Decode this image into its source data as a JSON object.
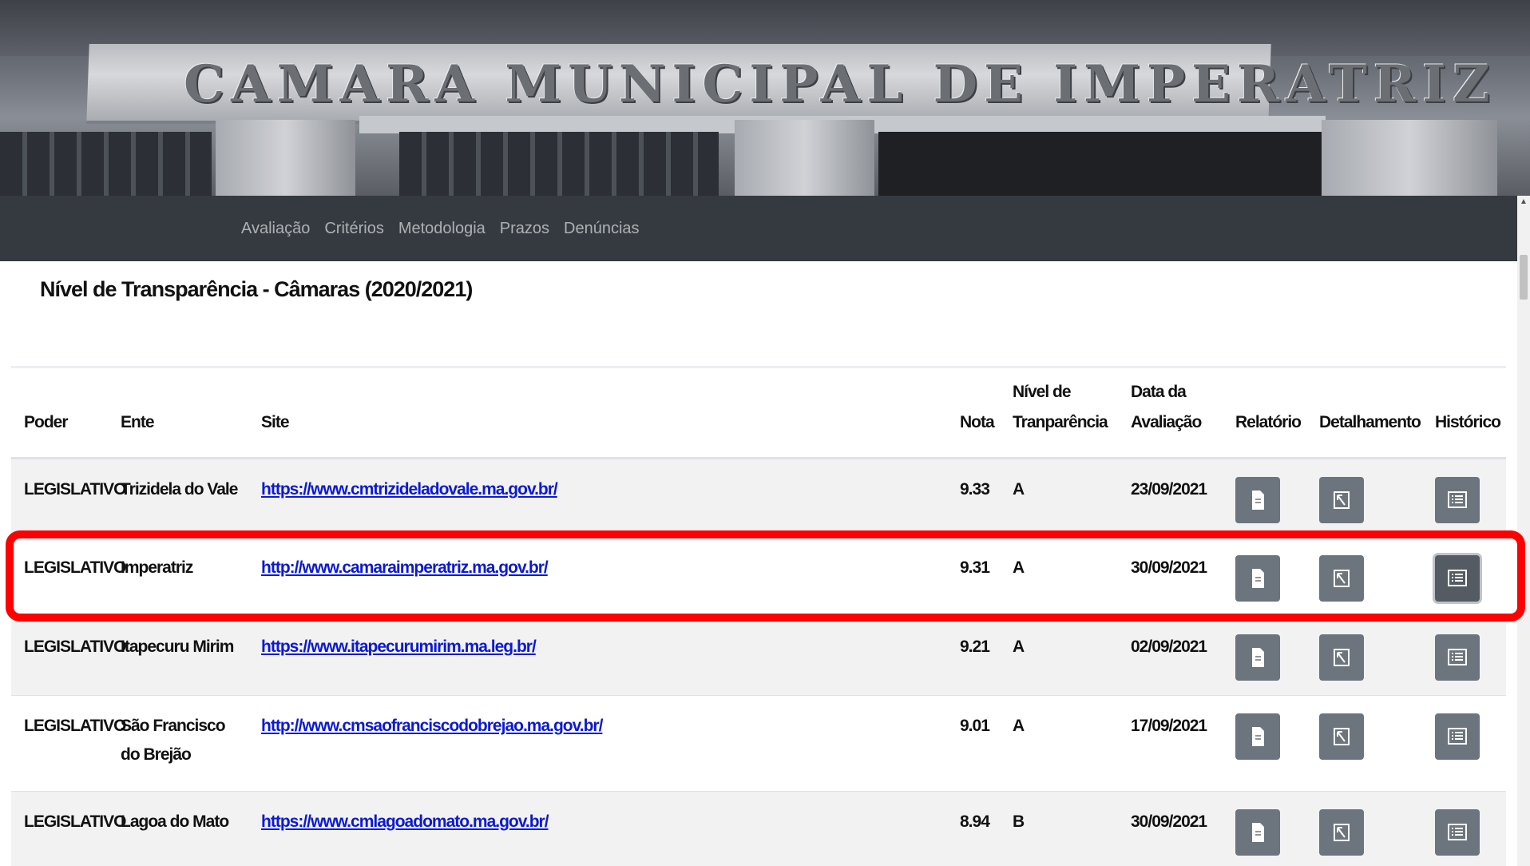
{
  "banner": {
    "sign_text": "CAMARA MUNICIPAL DE IMPERATRIZ"
  },
  "nav": {
    "items": [
      {
        "label": "Avaliação"
      },
      {
        "label": "Critérios"
      },
      {
        "label": "Metodologia"
      },
      {
        "label": "Prazos"
      },
      {
        "label": "Denúncias"
      }
    ]
  },
  "page": {
    "title": "Nível de Transparência - Câmaras (2020/2021)"
  },
  "table": {
    "headers": {
      "poder": "Poder",
      "ente": "Ente",
      "site": "Site",
      "nota": "Nota",
      "nivel_line1": "Nível de",
      "nivel_line2": "Tranparência",
      "data_line1": "Data da",
      "data_line2": "Avaliação",
      "relatorio": "Relatório",
      "detalhamento": "Detalhamento",
      "historico": "Histórico"
    },
    "rows": [
      {
        "poder": "LEGISLATIVO",
        "ente": "Trizidela do Vale",
        "site": "https://www.cmtrizideladovale.ma.gov.br/",
        "nota": "9.33",
        "nivel": "A",
        "data": "23/09/2021"
      },
      {
        "poder": "LEGISLATIVO",
        "ente": "Imperatriz",
        "site": "http://www.camaraimperatriz.ma.gov.br/",
        "nota": "9.31",
        "nivel": "A",
        "data": "30/09/2021"
      },
      {
        "poder": "LEGISLATIVO",
        "ente": "Itapecuru Mirim",
        "site": "https://www.itapecurumirim.ma.leg.br/",
        "nota": "9.21",
        "nivel": "A",
        "data": "02/09/2021"
      },
      {
        "poder": "LEGISLATIVO",
        "ente": "São Francisco do Brejão",
        "site": "http://www.cmsaofranciscodobrejao.ma.gov.br/",
        "nota": "9.01",
        "nivel": "A",
        "data": "17/09/2021"
      },
      {
        "poder": "LEGISLATIVO",
        "ente": "Lagoa do Mato",
        "site": "https://www.cmlagoadomato.ma.gov.br/",
        "nota": "8.94",
        "nivel": "B",
        "data": "30/09/2021"
      }
    ]
  },
  "highlight": {
    "row_index": 1,
    "color": "#ff0000"
  },
  "colors": {
    "navbar": "#343a40",
    "button": "#6c757d",
    "link": "#0a19d6"
  }
}
